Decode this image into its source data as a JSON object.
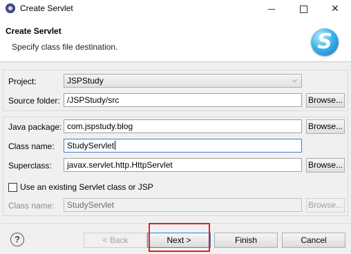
{
  "window": {
    "title": "Create Servlet"
  },
  "header": {
    "title": "Create Servlet",
    "subtitle": "Specify class file destination."
  },
  "form": {
    "project": {
      "label": "Project:",
      "value": "JSPStudy"
    },
    "source_folder": {
      "label": "Source folder:",
      "value": "/JSPStudy/src",
      "browse": "Browse..."
    },
    "java_package": {
      "label": "Java package:",
      "value": "com.jspstudy.blog",
      "browse": "Browse..."
    },
    "class_name": {
      "label": "Class name:",
      "value": "StudyServlet"
    },
    "superclass": {
      "label": "Superclass:",
      "value": "javax.servlet.http.HttpServlet",
      "browse": "Browse..."
    },
    "existing": {
      "label": "Use an existing Servlet class or JSP",
      "checked": false
    },
    "existing_class": {
      "label": "Class name:",
      "value": "StudyServlet",
      "browse": "Browse..."
    }
  },
  "footer": {
    "help": "?",
    "back": "< Back",
    "next": "Next >",
    "finish": "Finish",
    "cancel": "Cancel"
  },
  "colors": {
    "highlight": "#e02020",
    "focus_border": "#3c7fd6"
  },
  "icons": [
    "app-icon",
    "minimize-icon",
    "maximize-icon",
    "close-icon",
    "servlet-logo-icon",
    "chevron-down-icon",
    "help-icon"
  ]
}
